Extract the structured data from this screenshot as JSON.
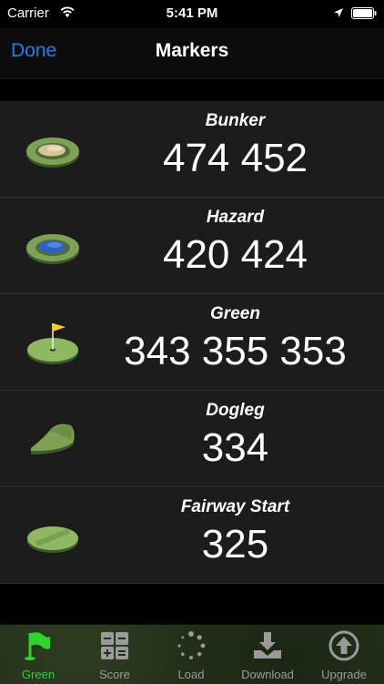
{
  "status_bar": {
    "carrier": "Carrier",
    "time": "5:41 PM"
  },
  "nav": {
    "done_label": "Done",
    "title": "Markers"
  },
  "markers": [
    {
      "label": "Bunker",
      "value": "474 452",
      "icon": "bunker-icon"
    },
    {
      "label": "Hazard",
      "value": "420 424",
      "icon": "hazard-icon"
    },
    {
      "label": "Green",
      "value": "343 355 353",
      "icon": "green-flag-icon"
    },
    {
      "label": "Dogleg",
      "value": "334",
      "icon": "dogleg-icon"
    },
    {
      "label": "Fairway Start",
      "value": "325",
      "icon": "fairway-icon"
    }
  ],
  "tabs": [
    {
      "label": "Green",
      "icon": "flag-icon",
      "active": true
    },
    {
      "label": "Score",
      "icon": "calculator-icon",
      "active": false
    },
    {
      "label": "Load",
      "icon": "spinner-icon",
      "active": false
    },
    {
      "label": "Download",
      "icon": "download-icon",
      "active": false
    },
    {
      "label": "Upgrade",
      "icon": "upgrade-arrow-icon",
      "active": false
    }
  ],
  "colors": {
    "accent_blue": "#1f7fe6",
    "active_green": "#2dd42d",
    "tab_background": "#233019"
  }
}
